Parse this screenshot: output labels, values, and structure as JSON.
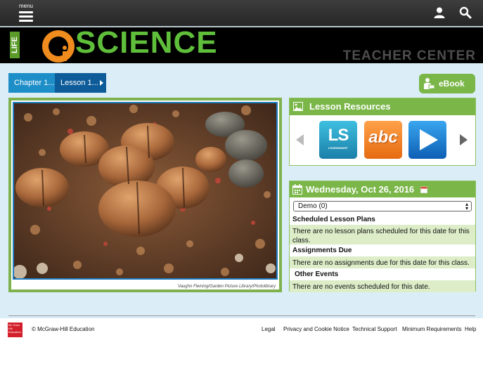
{
  "topbar": {
    "menu_label": "menu",
    "user_icon": "user-icon",
    "search_icon": "search-icon"
  },
  "banner": {
    "life": "LIFE",
    "science": "SCIENCE",
    "teacher_center": "TEACHER CENTER"
  },
  "breadcrumb": {
    "chapter": "Chapter 1...",
    "lesson": "Lesson 1..."
  },
  "ebook_label": "eBook",
  "photo_credit": "Vaughn Fleming/Garden Picture Library/Photolibrary",
  "lesson_resources": {
    "title": "Lesson Resources",
    "tiles": [
      {
        "name": "LS",
        "caption": "LEARNSMART",
        "icon": "learnsmart-icon"
      },
      {
        "name": "abc",
        "icon": "vocabulary-icon"
      },
      {
        "icon": "play-video-icon"
      }
    ]
  },
  "calendar": {
    "date": "Wednesday, Oct 26, 2016",
    "class_select": "Demo (0)",
    "scheduled_heading": "Scheduled Lesson Plans",
    "scheduled_text": "There are no lesson plans scheduled for this date for this class.",
    "assignments_heading": "Assignments Due",
    "assignments_text": "There are no assignments due for this date for this class.",
    "events_heading": "Other Events",
    "events_text": "There are no events scheduled for this date."
  },
  "footer": {
    "logo_text": "Mc Graw Hill Education",
    "copyright": "© McGraw-Hill Education",
    "links": [
      "Legal",
      "Privacy and Cookie Notice",
      "Technical Support",
      "Minimum Requirements",
      "Help"
    ]
  },
  "colors": {
    "accent_green": "#7ab648",
    "breadcrumb_blue": "#1e8ec8",
    "breadcrumb_dark": "#0d5c99",
    "content_bg": "#dbeef7",
    "logo_orange": "#f08c1e"
  }
}
